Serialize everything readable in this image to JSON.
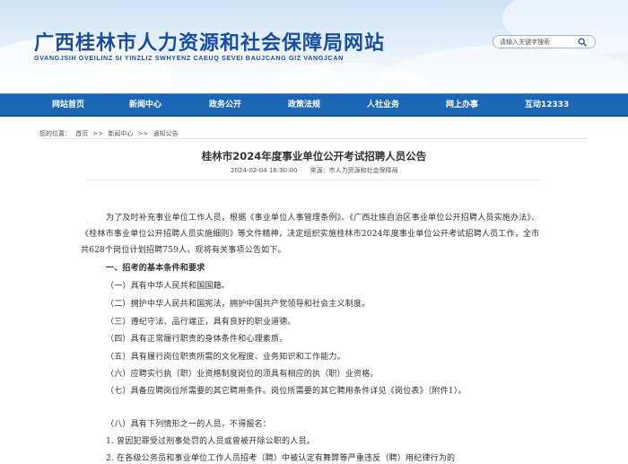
{
  "header": {
    "title": "广西桂林市人力资源和社会保障局网站",
    "subtitle": "GVANGJSIH GVEILINZ SI YINZLIZ SWHYENZ CAEUQ SEVEI BAUJCANG GIZ VANGJCAN",
    "search": {
      "placeholder": "请输入关键字搜索",
      "icon": "search-icon"
    }
  },
  "nav": {
    "items": [
      "网站首页",
      "新闻中心",
      "政务公开",
      "政策法规",
      "人社业务",
      "网上办事",
      "互动12333"
    ]
  },
  "breadcrumb": {
    "label": "您的位置：",
    "items": [
      "首页",
      "新闻中心",
      "通知公告"
    ],
    "separator": ">>"
  },
  "article": {
    "title": "桂林市2024年度事业单位公开考试招聘人员公告",
    "date": "2024-02-04 16:30:00",
    "source_label": "来源：",
    "source": "市人力资源和社会保障局",
    "paragraphs": [
      "为了及时补充事业单位工作人员，根据《事业单位人事管理条例》、《广西壮族自治区事业单位公开招聘人员实施办法》、《桂林市事业单位公开招聘人员实施细则》等文件精神，决定组织实施桂林市2024年度事业单位公开考试招聘人员工作，全市共628个岗位计划招聘759人。现将有关事项公告如下。",
      "一、招考的基本条件和要求",
      "（一）具有中华人民共和国国籍。",
      "（二）拥护中华人民共和国宪法，拥护中国共产党领导和社会主义制度。",
      "（三）遵纪守法、品行端正，具有良好的职业道德。",
      "（四）具有正常履行职责的身体条件和心理素质。",
      "（五）具有履行岗位职责所需的文化程度、业务知识和工作能力。",
      "（六）应聘实行执（职）业资格制度岗位的须具有相应的执（职）业资格。",
      "（七）具备应聘岗位所需要的其它聘用条件。岗位所需要的其它聘用条件详见《岗位表》（附件1）。",
      "（八）具有下列情形之一的人员，不得报名：",
      "1. 曾因犯罪受过刑事处罚的人员或曾被开除公职的人员。",
      "2. 在各级公务员和事业单位工作人员招考（聘）中被认定有舞弊等严重违反（聘）用纪律行为的"
    ]
  }
}
